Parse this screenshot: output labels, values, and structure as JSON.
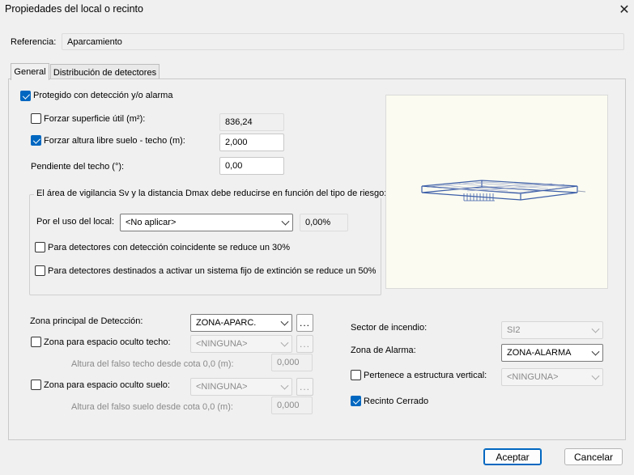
{
  "window": {
    "title": "Propiedades del local o recinto"
  },
  "referencia": {
    "label": "Referencia:",
    "value": "Aparcamiento"
  },
  "tabs": [
    {
      "label": "General"
    },
    {
      "label": "Distribución de detectores"
    }
  ],
  "general": {
    "protegido": {
      "label": "Protegido con detección y/o alarma",
      "checked": true
    },
    "forzar_superficie": {
      "label": "Forzar superficie útil (m²):",
      "value": "836,24",
      "checked": false
    },
    "forzar_altura": {
      "label": "Forzar altura libre suelo - techo (m):",
      "value": "2,000",
      "checked": true
    },
    "pendiente": {
      "label": "Pendiente del techo (°):",
      "value": "0,00"
    },
    "riesgo": {
      "title": "El área de vigilancia Sv y la distancia Dmax debe reducirse en función del tipo de riesgo:",
      "uso_label": "Por el uso del local:",
      "uso_value": "<No aplicar>",
      "uso_percent": "0,00%",
      "coincidente": {
        "label": "Para detectores con detección coincidente se reduce un 30%",
        "checked": false
      },
      "extincion": {
        "label": "Para detectores destinados a activar un sistema fijo de extinción se reduce un 50%",
        "checked": false
      }
    },
    "zona_principal": {
      "label": "Zona principal de Detección:",
      "value": "ZONA-APARC."
    },
    "zona_techo": {
      "label": "Zona para espacio oculto techo:",
      "value": "<NINGUNA>",
      "checked": false
    },
    "altura_techo": {
      "label": "Altura del falso techo desde cota 0,0 (m):",
      "value": "0,000"
    },
    "zona_suelo": {
      "label": "Zona para espacio oculto suelo:",
      "value": "<NINGUNA>",
      "checked": false
    },
    "altura_suelo": {
      "label": "Altura del falso suelo desde cota 0,0 (m):",
      "value": "0,000"
    },
    "sector": {
      "label": "Sector de incendio:",
      "value": "SI2"
    },
    "zona_alarma": {
      "label": "Zona de Alarma:",
      "value": "ZONA-ALARMA"
    },
    "estructura_vertical": {
      "label": "Pertenece a estructura vertical:",
      "value": "<NINGUNA>",
      "checked": false
    },
    "recinto_cerrado": {
      "label": "Recinto Cerrado",
      "checked": true
    },
    "ellipsis": "..."
  },
  "buttons": {
    "ok": "Aceptar",
    "cancel": "Cancelar"
  },
  "icons": {
    "close": "close-icon",
    "chevron": "chevron-down-icon",
    "check": "check-icon"
  },
  "colors": {
    "accent": "#0067c0",
    "preview_bg": "#fbfbf1",
    "model_stroke": "#3d5fa8"
  }
}
